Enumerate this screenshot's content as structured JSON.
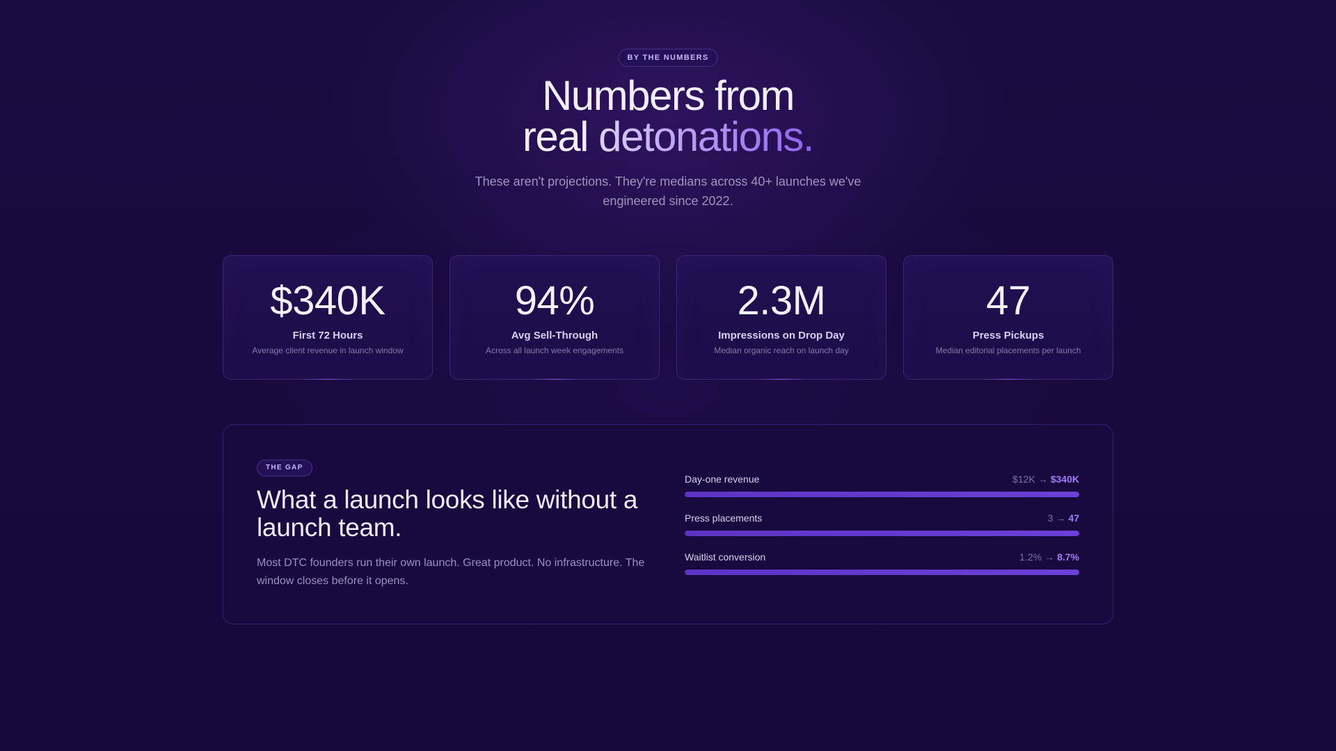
{
  "header": {
    "eyebrow": "BY THE NUMBERS",
    "headline_line1": "Numbers from",
    "headline_line2_plain": "real ",
    "headline_line2_accent": "detonations.",
    "subhead": "These aren't projections. They're medians across 40+ launches we've engineered since 2022."
  },
  "stats": [
    {
      "value": "$340K",
      "label": "First 72 Hours",
      "description": "Average client revenue in launch window"
    },
    {
      "value": "94%",
      "label": "Avg Sell-Through",
      "description": "Across all launch week engagements"
    },
    {
      "value": "2.3M",
      "label": "Impressions on Drop Day",
      "description": "Median organic reach on launch day"
    },
    {
      "value": "47",
      "label": "Press Pickups",
      "description": "Median editorial placements per launch"
    }
  ],
  "gap": {
    "tag": "THE GAP",
    "title": "What a launch looks like without a launch team.",
    "body": "Most DTC founders run their own launch. Great product. No infrastructure. The window closes before it opens.",
    "metrics": [
      {
        "label": "Day-one revenue",
        "before": "$12K",
        "arrow": "→",
        "after": "$340K",
        "fill": 1.0
      },
      {
        "label": "Press placements",
        "before": "3",
        "arrow": "→",
        "after": "47",
        "fill": 1.0
      },
      {
        "label": "Waitlist conversion",
        "before": "1.2%",
        "arrow": "→",
        "after": "8.7%",
        "fill": 1.0
      }
    ]
  },
  "colors": {
    "background": "#17093a",
    "accent": "#a27cf7",
    "bar": "#5b34c4"
  }
}
